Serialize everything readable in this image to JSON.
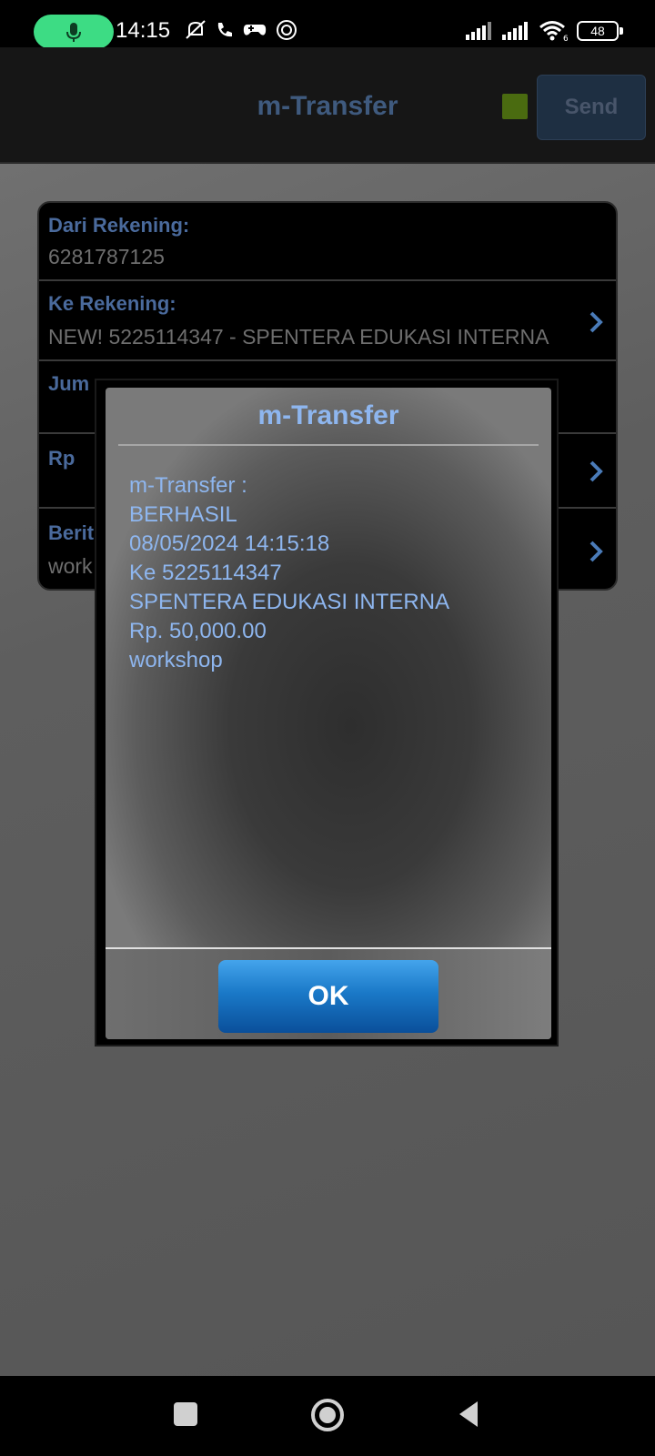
{
  "status_bar": {
    "time": "14:15",
    "battery": "48",
    "wifi_sub": "6"
  },
  "app_bar": {
    "title": "m-Transfer",
    "send_label": "Send"
  },
  "form": {
    "rows": [
      {
        "label": "Dari Rekening:",
        "value": "6281787125"
      },
      {
        "label": "Ke Rekening:",
        "value": "NEW! 5225114347 - SPENTERA EDUKASI INTERNA"
      },
      {
        "label": "Jum",
        "value": ""
      },
      {
        "label": "Rp",
        "value": ""
      },
      {
        "label": "Berit",
        "value": "work"
      }
    ]
  },
  "dialog": {
    "title": "m-Transfer",
    "message_lines": [
      "m-Transfer :",
      "BERHASIL",
      "08/05/2024 14:15:18",
      "Ke 5225114347",
      "SPENTERA EDUKASI INTERNA",
      "Rp. 50,000.00",
      "workshop"
    ],
    "ok_label": "OK"
  },
  "colors": {
    "accent_label": "#4a6a9c",
    "dialog_text": "#8eb6ef",
    "ok_button": "#1a79c8",
    "mic_pill": "#3ddc84"
  }
}
